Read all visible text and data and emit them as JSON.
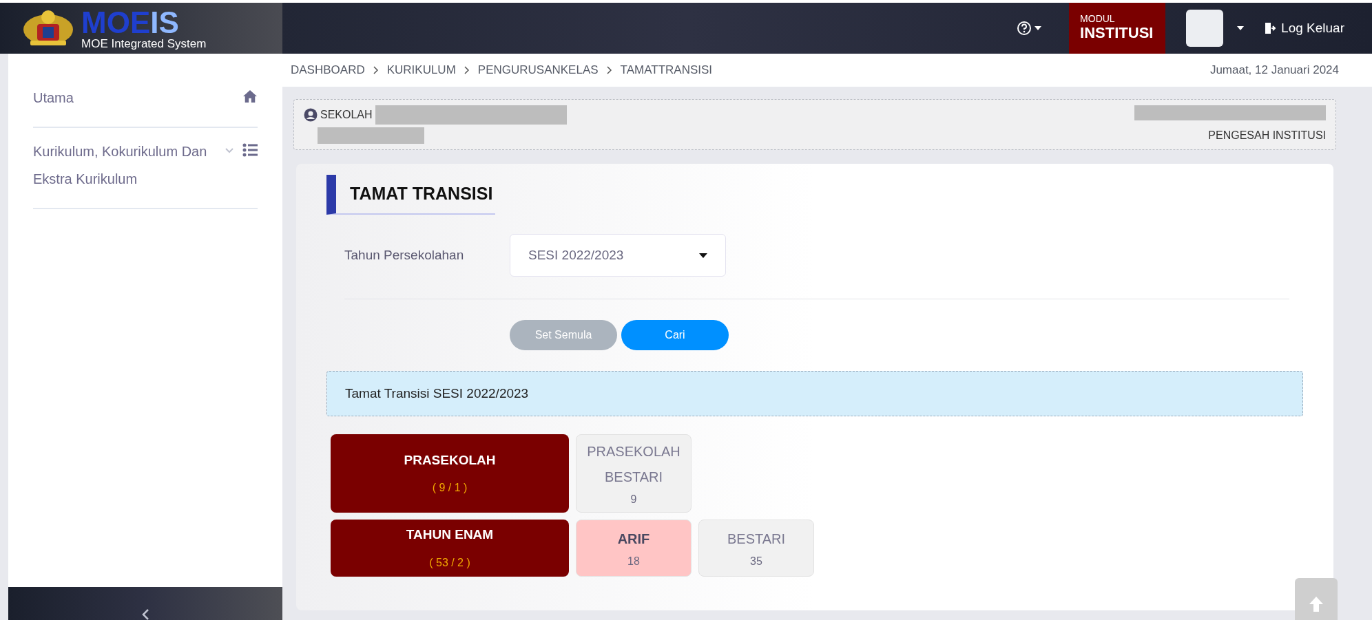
{
  "header": {
    "logo_parts": [
      "MOE",
      "IS"
    ],
    "logo_subtitle": "MOE Integrated System",
    "module_label": "MODUL",
    "module_name": "INSTITUSI",
    "logout": "Log Keluar"
  },
  "sidebar": {
    "items": [
      {
        "label": "Utama",
        "kind": "home"
      },
      {
        "label": "Kurikulum, Kokurikulum Dan Ekstra Kurikulum",
        "kind": "list",
        "expanded": false
      }
    ]
  },
  "breadcrumb": [
    "DASHBOARD",
    "KURIKULUM",
    "PENGURUSANKELAS",
    "TAMATTRANSISI"
  ],
  "date": "Jumaat, 12 Januari 2024",
  "info": {
    "school_label": "SEKOLAH",
    "role": "PENGESAH INSTITUSI"
  },
  "section_title": "TAMAT TRANSISI",
  "form": {
    "label": "Tahun Persekolahan",
    "value": "SESI 2022/2023"
  },
  "buttons": [
    {
      "label": "Set Semula",
      "kind": "reset"
    },
    {
      "label": "Cari",
      "kind": "primary"
    }
  ],
  "result_title": "Tamat Transisi SESI 2022/2023",
  "groups": [
    {
      "name": "PRASEKOLAH",
      "count": "( 9 / 1 )",
      "classes": [
        {
          "name": "PRASEKOLAH BESTARI",
          "count": "9",
          "selected": false
        }
      ]
    },
    {
      "name": "TAHUN ENAM",
      "count": "( 53 / 2 )",
      "classes": [
        {
          "name": "ARIF",
          "count": "18",
          "selected": true
        },
        {
          "name": "BESTARI",
          "count": "35",
          "selected": false
        }
      ]
    }
  ]
}
